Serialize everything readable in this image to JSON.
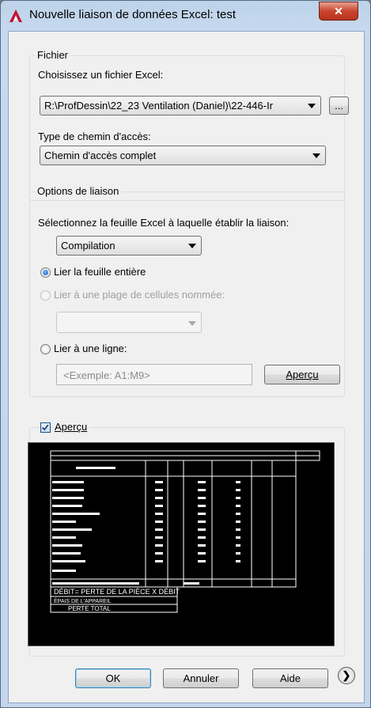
{
  "window": {
    "title": "Nouvelle liaison de données Excel: test",
    "close_glyph": "✕"
  },
  "file_group": {
    "legend": "Fichier",
    "choose_label": "Choisissez un fichier Excel:",
    "file_path": "R:\\ProfDessin\\22_23 Ventilation (Daniel)\\22-446-Ir",
    "browse_label": "...",
    "path_type_label": "Type de chemin d'accès:",
    "path_type_value": "Chemin d'accès complet"
  },
  "link_options": {
    "legend": "Options de liaison",
    "sheet_label": "Sélectionnez la feuille Excel à laquelle établir la liaison:",
    "sheet_value": "Compilation",
    "radio_entire_sheet": "Lier la feuille entière",
    "radio_named_range": "Lier à une plage de cellules nommée:",
    "radio_range": "Lier à une ligne:",
    "range_placeholder": "<Exemple: A1:M9>",
    "preview_button": "Aperçu"
  },
  "preview": {
    "checkbox_label": "Aperçu",
    "checked": true,
    "sheet_lines": [
      "DÉBIT= PERTE DE LA PIÈCE X DÉBIT",
      "ÉPAIS DE L'APPAREIL",
      "PERTE TOTAL"
    ]
  },
  "footer": {
    "ok": "OK",
    "cancel": "Annuler",
    "help": "Aide",
    "more_glyph": "❯"
  },
  "colors": {
    "accent": "#3c7fb1",
    "titlebar": "#c3d6ec",
    "close": "#c9452f"
  }
}
